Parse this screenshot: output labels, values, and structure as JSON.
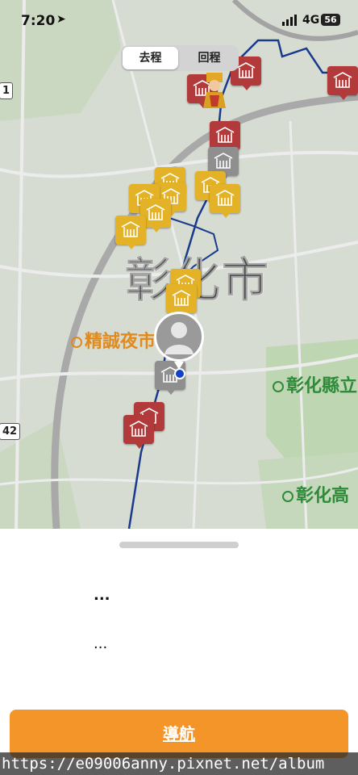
{
  "status_bar": {
    "time": "7:20",
    "network": "4G",
    "battery": "56"
  },
  "segmented": {
    "option_1": "去程",
    "option_2": "回程"
  },
  "map": {
    "city_label": "彰化市",
    "poi_1": "精誠夜市",
    "poi_2": "彰化縣立",
    "poi_3": "彰化高",
    "road_label_1": "1",
    "road_label_2": "42"
  },
  "sheet": {
    "line_1": "...",
    "line_2": "...",
    "navigate_label": "導航"
  },
  "watermark": "https://e09006anny.pixnet.net/album",
  "colors": {
    "temple_red": "#b33a3a",
    "temple_yellow": "#e3b226",
    "temple_gray": "#8f8f8f",
    "nav_button": "#f4952a",
    "route": "#1a3a8c"
  }
}
